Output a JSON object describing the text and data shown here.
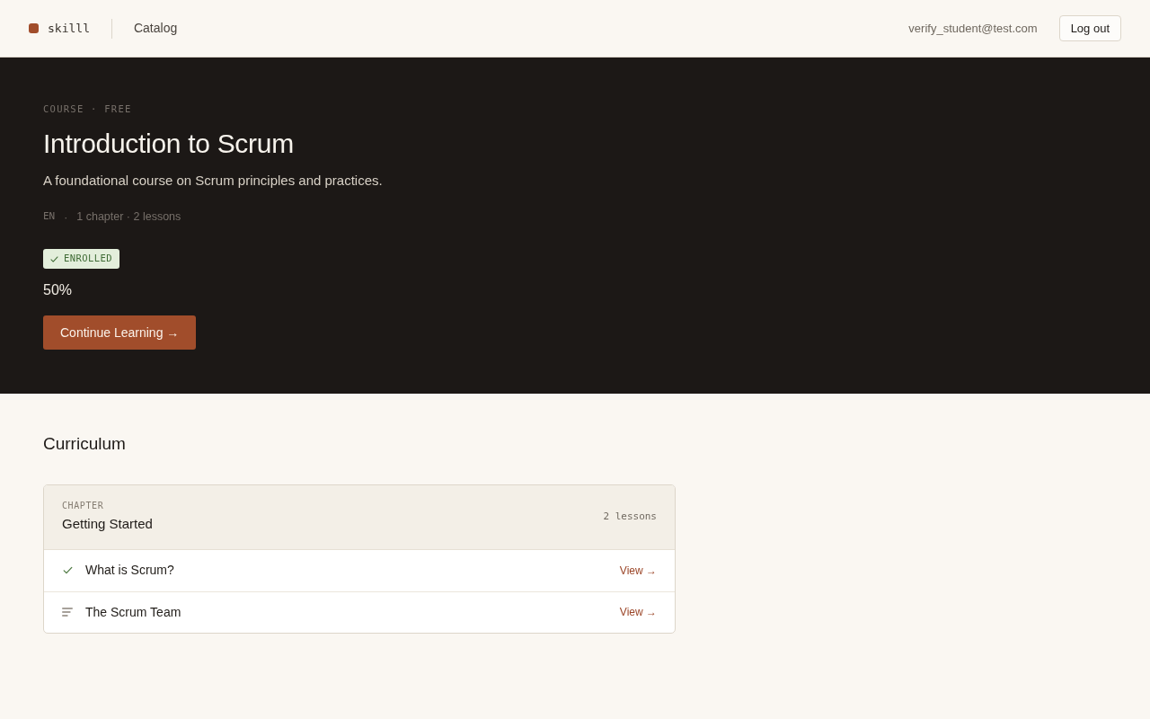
{
  "header": {
    "logo": "skilll",
    "nav": [
      {
        "label": "Catalog"
      }
    ],
    "user_email": "verify_student@test.com",
    "logout_button": "Log out"
  },
  "hero": {
    "eyebrow": "COURSE · FREE",
    "title": "Introduction to Scrum",
    "description": "A foundational course on Scrum principles and practices.",
    "language": "EN",
    "meta_separator": "·",
    "summary": "1 chapter · 2 lessons",
    "badge": {
      "label": "ENROLLED"
    },
    "progress": "50%",
    "cta_button": "Continue Learning →"
  },
  "curriculum": {
    "heading": "Curriculum",
    "chapters": [
      {
        "eyebrow": "CHAPTER",
        "title": "Getting Started",
        "count": "2 lessons",
        "lessons": [
          {
            "title": "What is Scrum?",
            "completed": true,
            "link": "View →"
          },
          {
            "title": "The Scrum Team",
            "completed": false,
            "link": "View →"
          }
        ]
      }
    ]
  }
}
